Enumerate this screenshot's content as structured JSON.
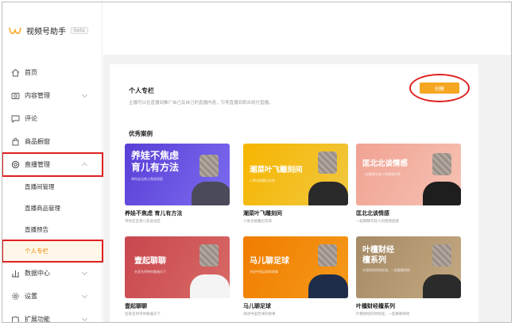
{
  "brand": {
    "name": "视频号助手",
    "beta": "beta"
  },
  "menu": {
    "home": "首页",
    "content": "内容管理",
    "comments": "评论",
    "shop": "商品橱窗",
    "live": "直播管理",
    "live_room": "直播间管理",
    "live_goods": "直播商品管理",
    "live_preview": "直播预告",
    "column": "个人专栏",
    "data": "数据中心",
    "settings": "设置",
    "extend": "扩展功能"
  },
  "panel": {
    "title": "个人专栏",
    "desc": "主播可以在直播间推广自己及自己的直播内容，引导直播间观众到付直播。",
    "create_label": "创建",
    "examples_title": "优秀案例"
  },
  "cards": [
    {
      "title_line1": "养娃不焦虑",
      "title_line2": "育儿有方法",
      "banner_sub": "带你走出育儿焦虑局面",
      "name": "养娃不焦虑 育儿有方法",
      "desc": "带你走出育儿焦虑误区"
    },
    {
      "title_line1": "潮菜叶飞雕刻间",
      "title_line2": "",
      "banner_sub": "小食也能雕出花来",
      "name": "潮菜叶飞雕刻间",
      "desc": "小食也能雕出花来"
    },
    {
      "title_line1": "匡北北谈情感",
      "title_line2": "",
      "banner_sub": "一起聊聊年轻人的情感世界",
      "name": "匡北北谈情感",
      "desc": "一起聊聊年轻人的情感困惑"
    },
    {
      "title_line1": "壹起聊聊",
      "title_line2": "",
      "banner_sub": "名家名师带你聊遍天下",
      "name": "壹起聊聊",
      "desc": "名家名师带你聊遍天下"
    },
    {
      "title_line1": "马儿聊足球",
      "title_line2": "",
      "banner_sub": "讲述中国足球的故事",
      "name": "马儿聊足球",
      "desc": "讲述中国足球的故事"
    },
    {
      "title_line1": "叶檀财经",
      "title_line2": "檀系列",
      "banner_sub": "叶檀财经的财经观，一起聊聊财经",
      "name": "叶檀财经檀系列",
      "desc": "叶檀财经的财经观，一起聊聊财经"
    }
  ],
  "colors": {
    "accent": "#f5a623",
    "highlight": "#e02020",
    "active_text": "#f08a00"
  }
}
